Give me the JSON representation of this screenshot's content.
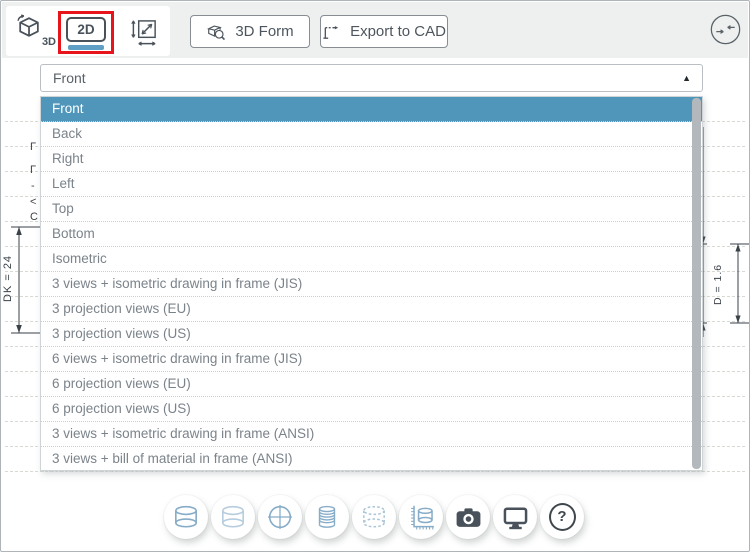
{
  "toolbar": {
    "mode_3d_label": "3D",
    "mode_2d_label": "2D",
    "form_3d_label": "3D Form",
    "export_cad_label": "Export to CAD"
  },
  "view_select": {
    "value": "Front",
    "arrow_glyph": "▲",
    "options": [
      "Front",
      "Back",
      "Right",
      "Left",
      "Top",
      "Bottom",
      "Isometric",
      "3 views + isometric drawing in frame (JIS)",
      "3 projection views (EU)",
      "3 projection views (US)",
      "6 views + isometric drawing in frame (JIS)",
      "6 projection views (EU)",
      "6 projection views (US)",
      "3 views + isometric drawing in frame (ANSI)",
      "3 views + bill of material in frame (ANSI)"
    ]
  },
  "drawing": {
    "left_dimension_label": "DK = 24",
    "right_dimension_label": "D = 1.6",
    "left_fragments": [
      "Γ",
      "Γ",
      "-",
      "<",
      "C"
    ]
  },
  "bottom_toolbar": {
    "help_glyph": "?",
    "icons": [
      "spring-side-view",
      "spring-side-light-view",
      "spring-top-view",
      "spring-solid-view",
      "spring-phantom-view",
      "spring-dimension-view",
      "screenshot",
      "fullscreen",
      "help"
    ]
  },
  "colors": {
    "selected_option_bg": "#4f96ba",
    "active_mode_underline": "#5f9fc6",
    "highlight_box": "#e8141b",
    "icon_blue": "#87acc8",
    "icon_dark": "#49525a"
  }
}
